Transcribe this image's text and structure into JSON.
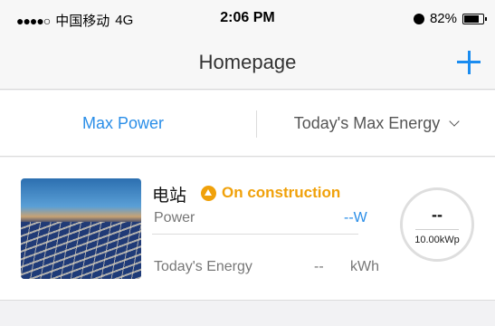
{
  "status_bar": {
    "signal": "●●●●○",
    "carrier": "中国移动",
    "network": "4G",
    "time": "2:06 PM",
    "battery_percent": "82%",
    "battery_level": 0.82
  },
  "nav": {
    "title": "Homepage",
    "add_icon": "plus-icon"
  },
  "tabs": {
    "left_label": "Max Power",
    "right_label": "Today's Max Energy"
  },
  "station": {
    "name": "电站",
    "status": "On construction",
    "status_color": "#f0a10a",
    "power_label": "Power",
    "power_value": "--W",
    "energy_label": "Today's Energy",
    "energy_value": "--",
    "energy_unit": "kWh",
    "gauge_value": "--",
    "capacity": "10.00kWp"
  },
  "colors": {
    "accent": "#2a8ee8",
    "warning": "#f0a10a"
  }
}
